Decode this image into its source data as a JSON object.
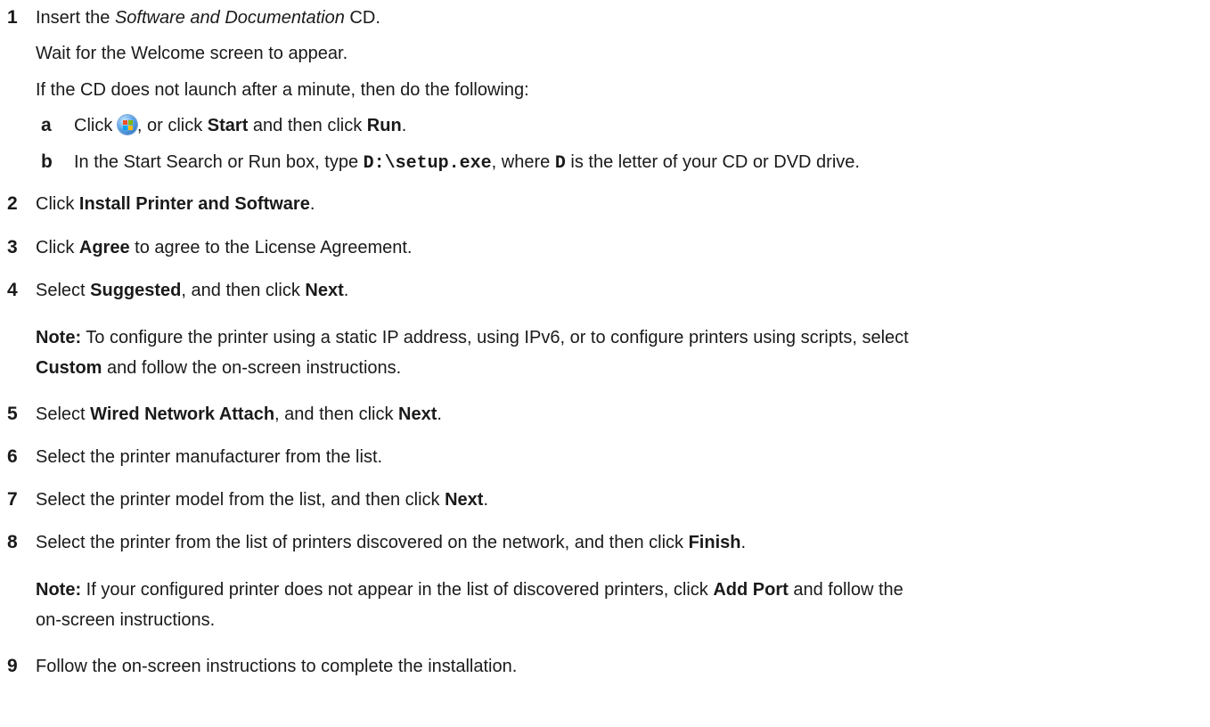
{
  "steps": [
    {
      "n": "1",
      "text_a": "Insert the ",
      "text_em": "Software and Documentation",
      "text_b": " CD."
    },
    {
      "n": "2",
      "a": "Click ",
      "b1": "Install Printer and Software",
      "c": "."
    },
    {
      "n": "3",
      "a": "Click ",
      "b1": "Agree",
      "c": " to agree to the License Agreement."
    },
    {
      "n": "4",
      "a": "Select ",
      "b1": "Suggested",
      "m": ", and then click ",
      "b2": "Next",
      "c": "."
    },
    {
      "n": "5",
      "a": "Select ",
      "b1": "Wired Network Attach",
      "m": ", and then click ",
      "b2": "Next",
      "c": "."
    },
    {
      "n": "6",
      "a": "Select the printer manufacturer from the list."
    },
    {
      "n": "7",
      "a": "Select the printer model from the list, and then click ",
      "b1": "Next",
      "c": "."
    },
    {
      "n": "8",
      "a": "Select the printer from the list of printers discovered on the network, and then click ",
      "b1": "Finish",
      "c": "."
    },
    {
      "n": "9",
      "a": "Follow the on-screen instructions to complete the installation."
    }
  ],
  "step1_wait": "Wait for the Welcome screen to appear.",
  "step1_if": "If the CD does not launch after a minute, then do the following:",
  "substeps": {
    "a": {
      "letter": "a",
      "t1": "Click ",
      "t2": ", or click ",
      "b1": "Start",
      "t3": " and then click ",
      "b2": "Run",
      "t4": ".",
      "icon": "windows-start-orb-icon"
    },
    "b": {
      "letter": "b",
      "t1": "In the Start Search or Run box, type ",
      "code1": "D:\\setup.exe",
      "t2": ", where ",
      "code2": "D",
      "t3": " is the letter of your CD or DVD drive."
    }
  },
  "notes": {
    "note1": {
      "label": "Note:",
      "l1": " To configure the printer using a static IP address, using IPv6, or to configure printers using scripts, select",
      "b1": "Custom",
      "l2": " and follow the on-screen instructions."
    },
    "note2": {
      "label": "Note:",
      "l1": " If your configured printer does not appear in the list of discovered printers, click ",
      "b1": "Add Port",
      "l2": " and follow the",
      "l3": "on-screen instructions."
    }
  }
}
